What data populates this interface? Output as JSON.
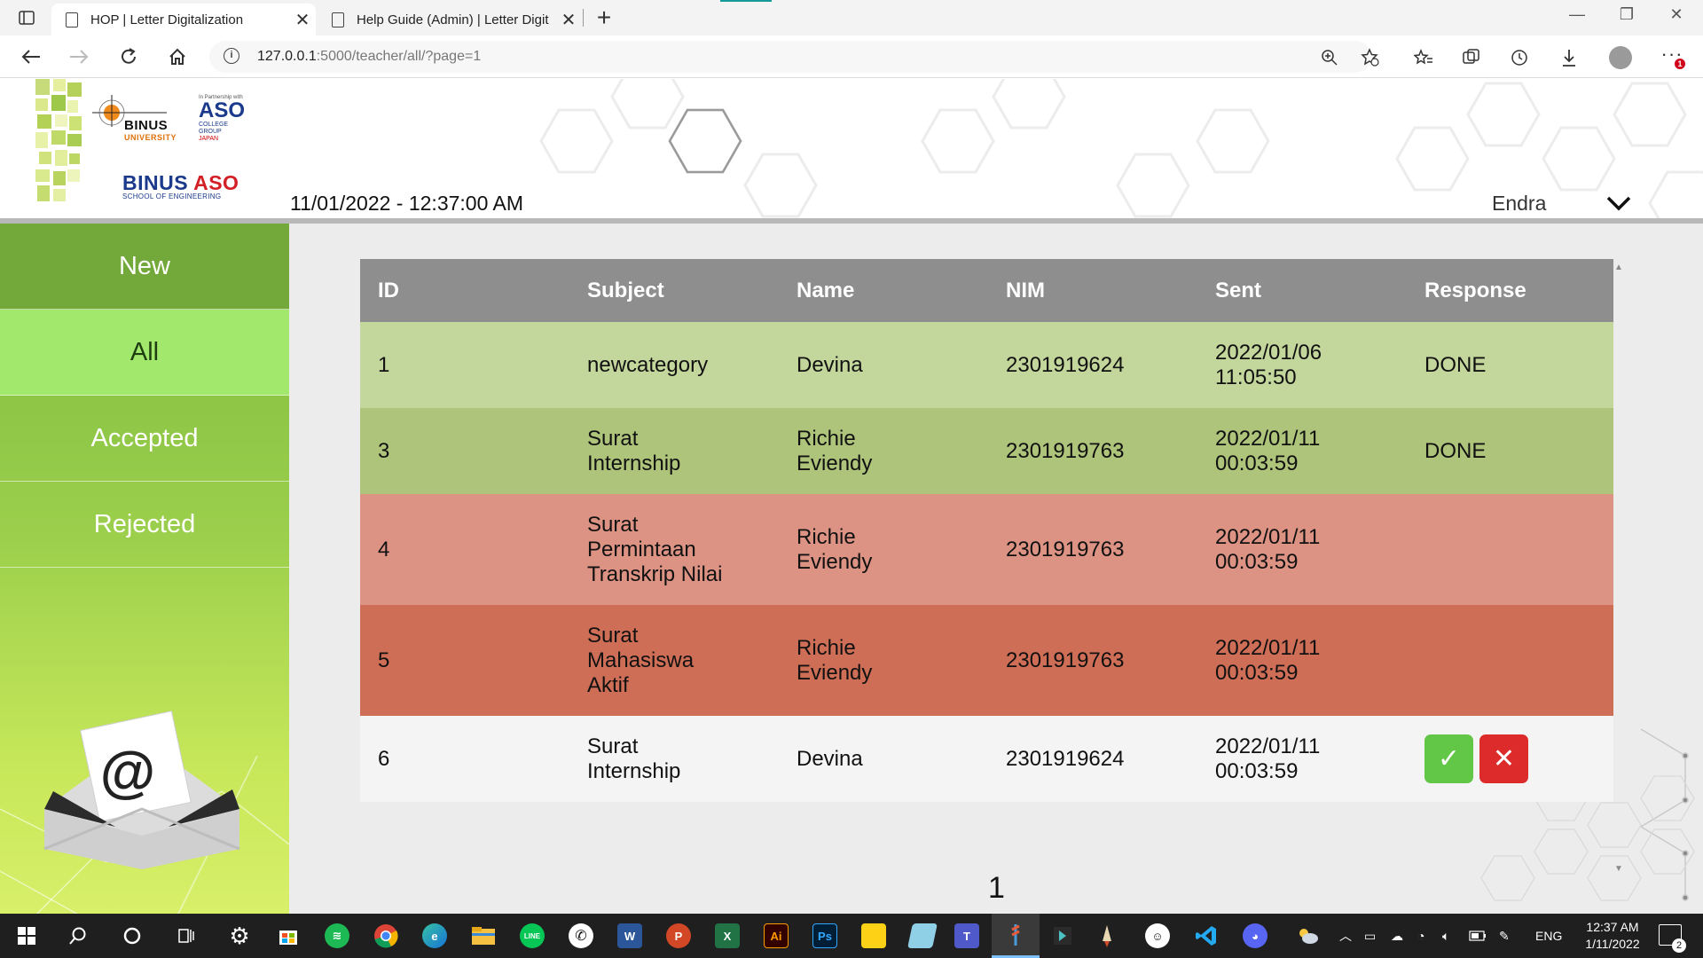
{
  "browser": {
    "tabs": [
      {
        "title": "HOP | Letter Digitalization",
        "active": true
      },
      {
        "title": "Help Guide (Admin) | Letter Digit",
        "active": false
      }
    ],
    "url_host": "127.0.0.1",
    "url_path": ":5000/teacher/all/?page=1",
    "close_glyph": "✕",
    "new_tab_glyph": "+",
    "notification_count": "1"
  },
  "header": {
    "logo_binus_word": "BINUS",
    "logo_binus_uni": "UNIVERSITY",
    "logo_aso_small": "In Partnership with",
    "logo_aso_word": "ASO",
    "logo_aso_sub1": "COLLEGE",
    "logo_aso_sub2": "GROUP",
    "logo_aso_jp": "JAPAN",
    "logo_binusaso_a": "BINUS ",
    "logo_binusaso_b": "ASO",
    "logo_binusaso_sub": "SCHOOL OF ENGINEERING",
    "datetime": "11/01/2022 - 12:37:00 AM",
    "user": "Endra"
  },
  "sidebar": {
    "items": [
      {
        "label": "New",
        "active": false
      },
      {
        "label": "All",
        "active": true
      },
      {
        "label": "Accepted",
        "active": false
      },
      {
        "label": "Rejected",
        "active": false
      }
    ],
    "envelope_symbol": "@"
  },
  "table": {
    "columns": [
      "ID",
      "Subject",
      "Name",
      "NIM",
      "Sent",
      "Response"
    ],
    "rows": [
      {
        "id": "1",
        "subject_lines": [
          "newcategory"
        ],
        "name_lines": [
          "Devina"
        ],
        "nim": "2301919624",
        "sent_lines": [
          "2022/01/06",
          "11:05:50"
        ],
        "response": "DONE",
        "status": "done"
      },
      {
        "id": "3",
        "subject_lines": [
          "Surat",
          "Internship"
        ],
        "name_lines": [
          "Richie",
          "Eviendy"
        ],
        "nim": "2301919763",
        "sent_lines": [
          "2022/01/11",
          "00:03:59"
        ],
        "response": "DONE",
        "status": "done"
      },
      {
        "id": "4",
        "subject_lines": [
          "Surat",
          "Permintaan",
          "Transkrip Nilai"
        ],
        "name_lines": [
          "Richie",
          "Eviendy"
        ],
        "nim": "2301919763",
        "sent_lines": [
          "2022/01/11",
          "00:03:59"
        ],
        "response": "",
        "status": "rejected"
      },
      {
        "id": "5",
        "subject_lines": [
          "Surat",
          "Mahasiswa",
          "Aktif"
        ],
        "name_lines": [
          "Richie",
          "Eviendy"
        ],
        "nim": "2301919763",
        "sent_lines": [
          "2022/01/11",
          "00:03:59"
        ],
        "response": "",
        "status": "rejected"
      },
      {
        "id": "6",
        "subject_lines": [
          "Surat",
          "Internship"
        ],
        "name_lines": [
          "Devina"
        ],
        "nim": "2301919624",
        "sent_lines": [
          "2022/01/11",
          "00:03:59"
        ],
        "response": "",
        "status": "pending"
      }
    ],
    "accept_glyph": "✓",
    "reject_glyph": "✕"
  },
  "pagination": {
    "current": "1"
  },
  "colors": {
    "header_bg": "#8e8e8e",
    "row_done_1": "#c3d69b",
    "row_done_2": "#adc47a",
    "row_rejected_1": "#dd9384",
    "row_rejected_2": "#cf6e56",
    "row_pending": "#f4f4f4",
    "accept": "#62c747",
    "reject": "#dd2a2a",
    "sidebar_active": "#a2e86c"
  },
  "taskbar": {
    "apps": [
      "start",
      "search",
      "cortana",
      "task-view",
      "settings",
      "store",
      "spotify",
      "chrome",
      "edge",
      "file-explorer",
      "line",
      "whatsapp",
      "word",
      "powerpoint",
      "excel",
      "illustrator",
      "photoshop",
      "sticky-notes",
      "notepad",
      "teams",
      "flask-app",
      "vs-app",
      "pencil-app",
      "chat-app",
      "vscode",
      "discord"
    ],
    "app_labels": {
      "word": "W",
      "powerpoint": "P",
      "excel": "X",
      "illustrator": "Ai",
      "photoshop": "Ps",
      "teams": "T",
      "line": "LINE"
    },
    "lang": "ENG",
    "time": "12:37 AM",
    "date": "1/11/2022",
    "notifications": "2"
  }
}
